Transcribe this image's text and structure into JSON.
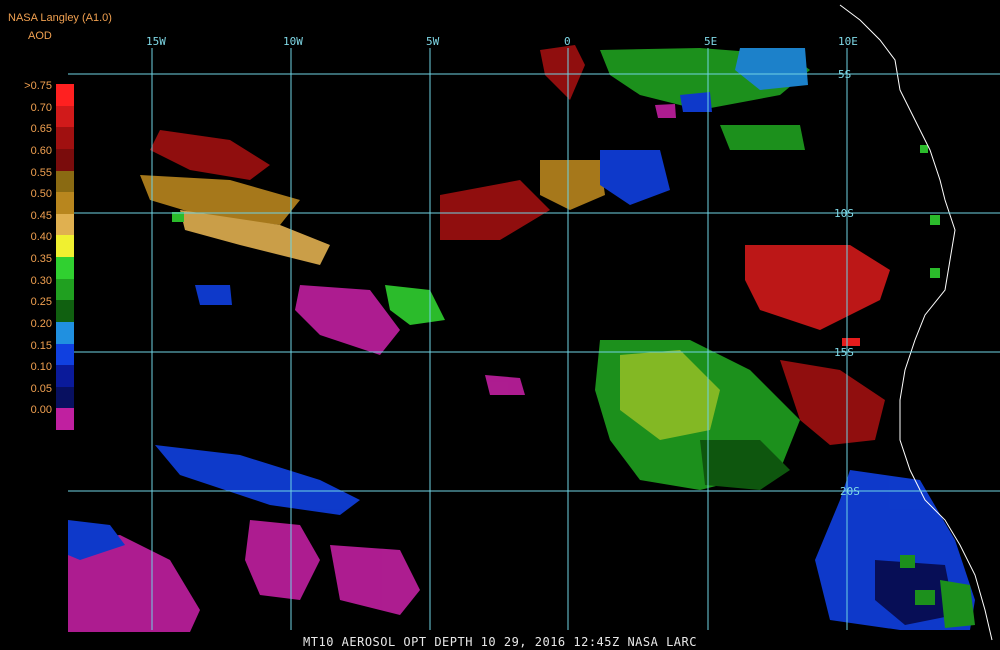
{
  "header": {
    "source": "NASA Langley (A1.0)",
    "product": "AOD"
  },
  "legend": {
    "labels": [
      ">0.75",
      "0.70",
      "0.65",
      "0.60",
      "0.55",
      "0.50",
      "0.45",
      "0.40",
      "0.35",
      "0.30",
      "0.25",
      "0.20",
      "0.15",
      "0.10",
      "0.05",
      "0.00"
    ],
    "colors": [
      "#ff2020",
      "#d11a1a",
      "#a01010",
      "#7a0c0c",
      "#8a6a12",
      "#b8861e",
      "#e0b050",
      "#f0f030",
      "#30d030",
      "#20a020",
      "#106010",
      "#2090e0",
      "#1040e0",
      "#0a1a9a",
      "#081060",
      "#c020a0"
    ]
  },
  "grid": {
    "lon_labels": [
      "15W",
      "10W",
      "5W",
      "0",
      "5E",
      "10E"
    ],
    "lat_labels": [
      "5S",
      "10S",
      "15S",
      "20S"
    ],
    "color": "#6fd4e4"
  },
  "caption": "MT10  AEROSOL OPT DEPTH   10 29, 2016 12:45Z   NASA LARC"
}
